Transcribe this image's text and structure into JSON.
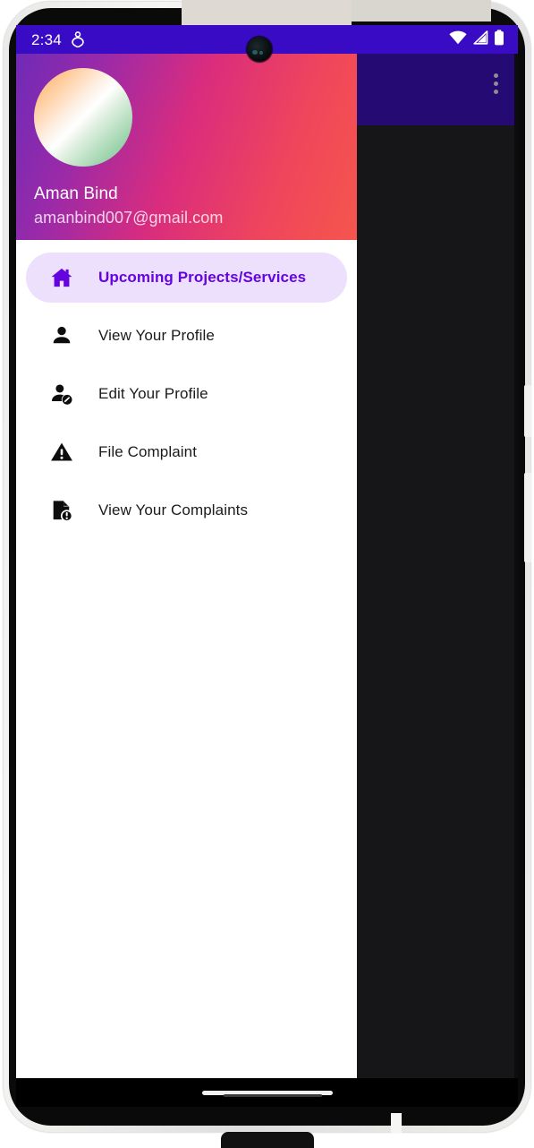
{
  "status_bar": {
    "time": "2:34",
    "location_icon": "location-shield-icon",
    "wifi_icon": "wifi-icon",
    "signal_icon": "cell-signal-icon",
    "battery_icon": "battery-full-icon",
    "background_color": "#3A0BC4"
  },
  "app_bar": {
    "overflow_menu_label": "More options",
    "background_color": "#260A73"
  },
  "drawer": {
    "header": {
      "avatar_label": "User avatar",
      "name": "Aman Bind",
      "email": "amanbind007@gmail.com",
      "gradient_start": "#6F2AB7",
      "gradient_end": "#F5564C"
    },
    "selected_index": 0,
    "selected_background": "#EDE0FC",
    "selected_text_color": "#6405E0",
    "items": [
      {
        "label": "Upcoming Projects/Services",
        "icon": "home-icon",
        "selected": true
      },
      {
        "label": "View Your Profile",
        "icon": "person-icon",
        "selected": false
      },
      {
        "label": "Edit Your Profile",
        "icon": "person-edit-icon",
        "selected": false
      },
      {
        "label": "File Complaint",
        "icon": "warning-triangle-icon",
        "selected": false
      },
      {
        "label": "View Your Complaints",
        "icon": "document-alert-icon",
        "selected": false
      }
    ]
  },
  "navigation_bar": {
    "gesture_pill_label": "Home gesture bar"
  }
}
